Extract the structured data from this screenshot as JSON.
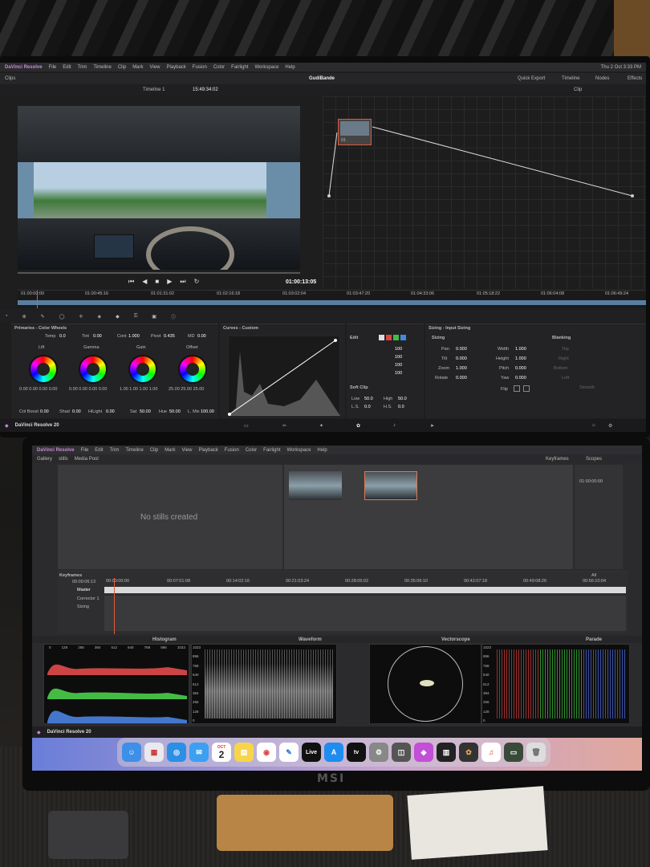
{
  "top_screen": {
    "menubar": {
      "app": "DaVinci Resolve",
      "items": [
        "File",
        "Edit",
        "Trim",
        "Timeline",
        "Clip",
        "Mark",
        "View",
        "Playback",
        "Fusion",
        "Color",
        "Fairlight",
        "Workspace",
        "Help"
      ],
      "clock": "Thu 2 Oct  3:33 PM"
    },
    "toolbar": {
      "clips": "Clips",
      "project": "GudiBande",
      "timeline": "Timeline 1",
      "timecode": "15:49:34:02",
      "quick_export": "Quick Export",
      "timeline_btn": "Timeline",
      "nodes_btn": "Nodes",
      "effects_btn": "Effects",
      "clip_mode": "Clip"
    },
    "viewer": {
      "timecode": "01:00:13:05",
      "ruler": [
        "01:00:00:00",
        "01:00:45:16",
        "01:01:31:02",
        "01:02:16:18",
        "01:03:02:04",
        "01:03:47:20",
        "01:04:33:06",
        "01:05:18:22",
        "01:06:04:08",
        "01:06:49:24"
      ],
      "node_label": "01"
    },
    "primaries": {
      "title": "Primaries - Color Wheels",
      "temp_label": "Temp",
      "temp": "0.0",
      "tint_label": "Tint",
      "tint": "0.00",
      "cont_label": "Cont",
      "cont": "1.000",
      "pivot_label": "Pivot",
      "pivot": "0.435",
      "md_label": "MD",
      "md": "0.00",
      "wheels": [
        {
          "name": "Lift",
          "values": "0.00  0.00  0.00  0.00"
        },
        {
          "name": "Gamma",
          "values": "0.00  0.00  0.00  0.00"
        },
        {
          "name": "Gain",
          "values": "1.00  1.00  1.00  1.00"
        },
        {
          "name": "Offset",
          "values": "25.00  25.00  25.00"
        }
      ],
      "col_boost_label": "Col Boost",
      "col_boost": "0.00",
      "shad_label": "Shad",
      "shad": "0.00",
      "hilight_label": "HiLight",
      "hilight": "0.00",
      "sat_label": "Sat",
      "sat": "50.00",
      "hue_label": "Hue",
      "hue": "50.00",
      "lmix_label": "L. Mix",
      "lmix": "100.00"
    },
    "curves": {
      "title": "Curves - Custom"
    },
    "edit": {
      "title": "Edit",
      "values": [
        "100",
        "100",
        "100",
        "100"
      ],
      "soft_clip": "Soft Clip",
      "low_label": "Low",
      "low": "50.0",
      "high_label": "High",
      "high": "50.0",
      "ls_label": "L.S.",
      "ls": "0.0",
      "hs_label": "H.S.",
      "hs": "0.0"
    },
    "sizing": {
      "title": "Sizing - Input Sizing",
      "section": "Sizing",
      "pan_label": "Pan",
      "pan": "0.000",
      "tilt_label": "Tilt",
      "tilt": "0.000",
      "zoom_label": "Zoom",
      "zoom": "1.000",
      "rotate_label": "Rotate",
      "rotate": "0.000",
      "width_label": "Width",
      "width": "1.000",
      "height_label": "Height",
      "height": "1.000",
      "pitch_label": "Pitch",
      "pitch": "0.000",
      "yaw_label": "Yaw",
      "yaw": "0.000",
      "flip_label": "Flip",
      "blanking": "Blanking",
      "top": "Top",
      "right": "Right",
      "bottom": "Bottom",
      "left": "Left",
      "smooth": "Smooth"
    },
    "footer": {
      "brand": "DaVinci Resolve 20"
    }
  },
  "bottom_screen": {
    "menubar": {
      "app": "DaVinci Resolve",
      "items": [
        "File",
        "Edit",
        "Trim",
        "Timeline",
        "Clip",
        "Mark",
        "View",
        "Playback",
        "Fusion",
        "Color",
        "Fairlight",
        "Workspace",
        "Help"
      ]
    },
    "toolbar": {
      "gallery": "Gallery",
      "stills": "stills",
      "media_pool": "Media Pool",
      "keyframes": "Keyframes",
      "scopes": "Scopes"
    },
    "gallery_message": "No stills created",
    "node_timecode": "01:00:00:00",
    "keyframes": {
      "title": "Keyframes",
      "all": "All",
      "timecode": "00:00:06:13",
      "ruler": [
        "00:00:00:00",
        "00:07:01:08",
        "00:14:02:16",
        "00:21:03:24",
        "00:28:05:02",
        "00:35:06:10",
        "00:42:07:18",
        "00:49:08:26",
        "00:56:10:04"
      ],
      "tracks": [
        "Master",
        "Corrector 1",
        "Sizing"
      ]
    },
    "scopes": [
      {
        "name": "Histogram",
        "ticks": [
          "0",
          "128",
          "256",
          "384",
          "512",
          "640",
          "768",
          "896",
          "1023"
        ]
      },
      {
        "name": "Waveform",
        "ticks": [
          "1023",
          "896",
          "768",
          "640",
          "512",
          "384",
          "256",
          "128",
          "0"
        ]
      },
      {
        "name": "Vectorscope"
      },
      {
        "name": "Parade",
        "ticks": [
          "1023",
          "896",
          "768",
          "640",
          "512",
          "384",
          "256",
          "128",
          "0"
        ]
      }
    ],
    "footer": {
      "brand": "DaVinci Resolve 20"
    },
    "dock_date": "2",
    "dock_month": "OCT",
    "dock_live": "Live"
  },
  "monitor_brand": "MSI",
  "colors": {
    "accent": "#e05a3a",
    "resolve_purple": "#c58bd0",
    "panel": "#232325"
  }
}
